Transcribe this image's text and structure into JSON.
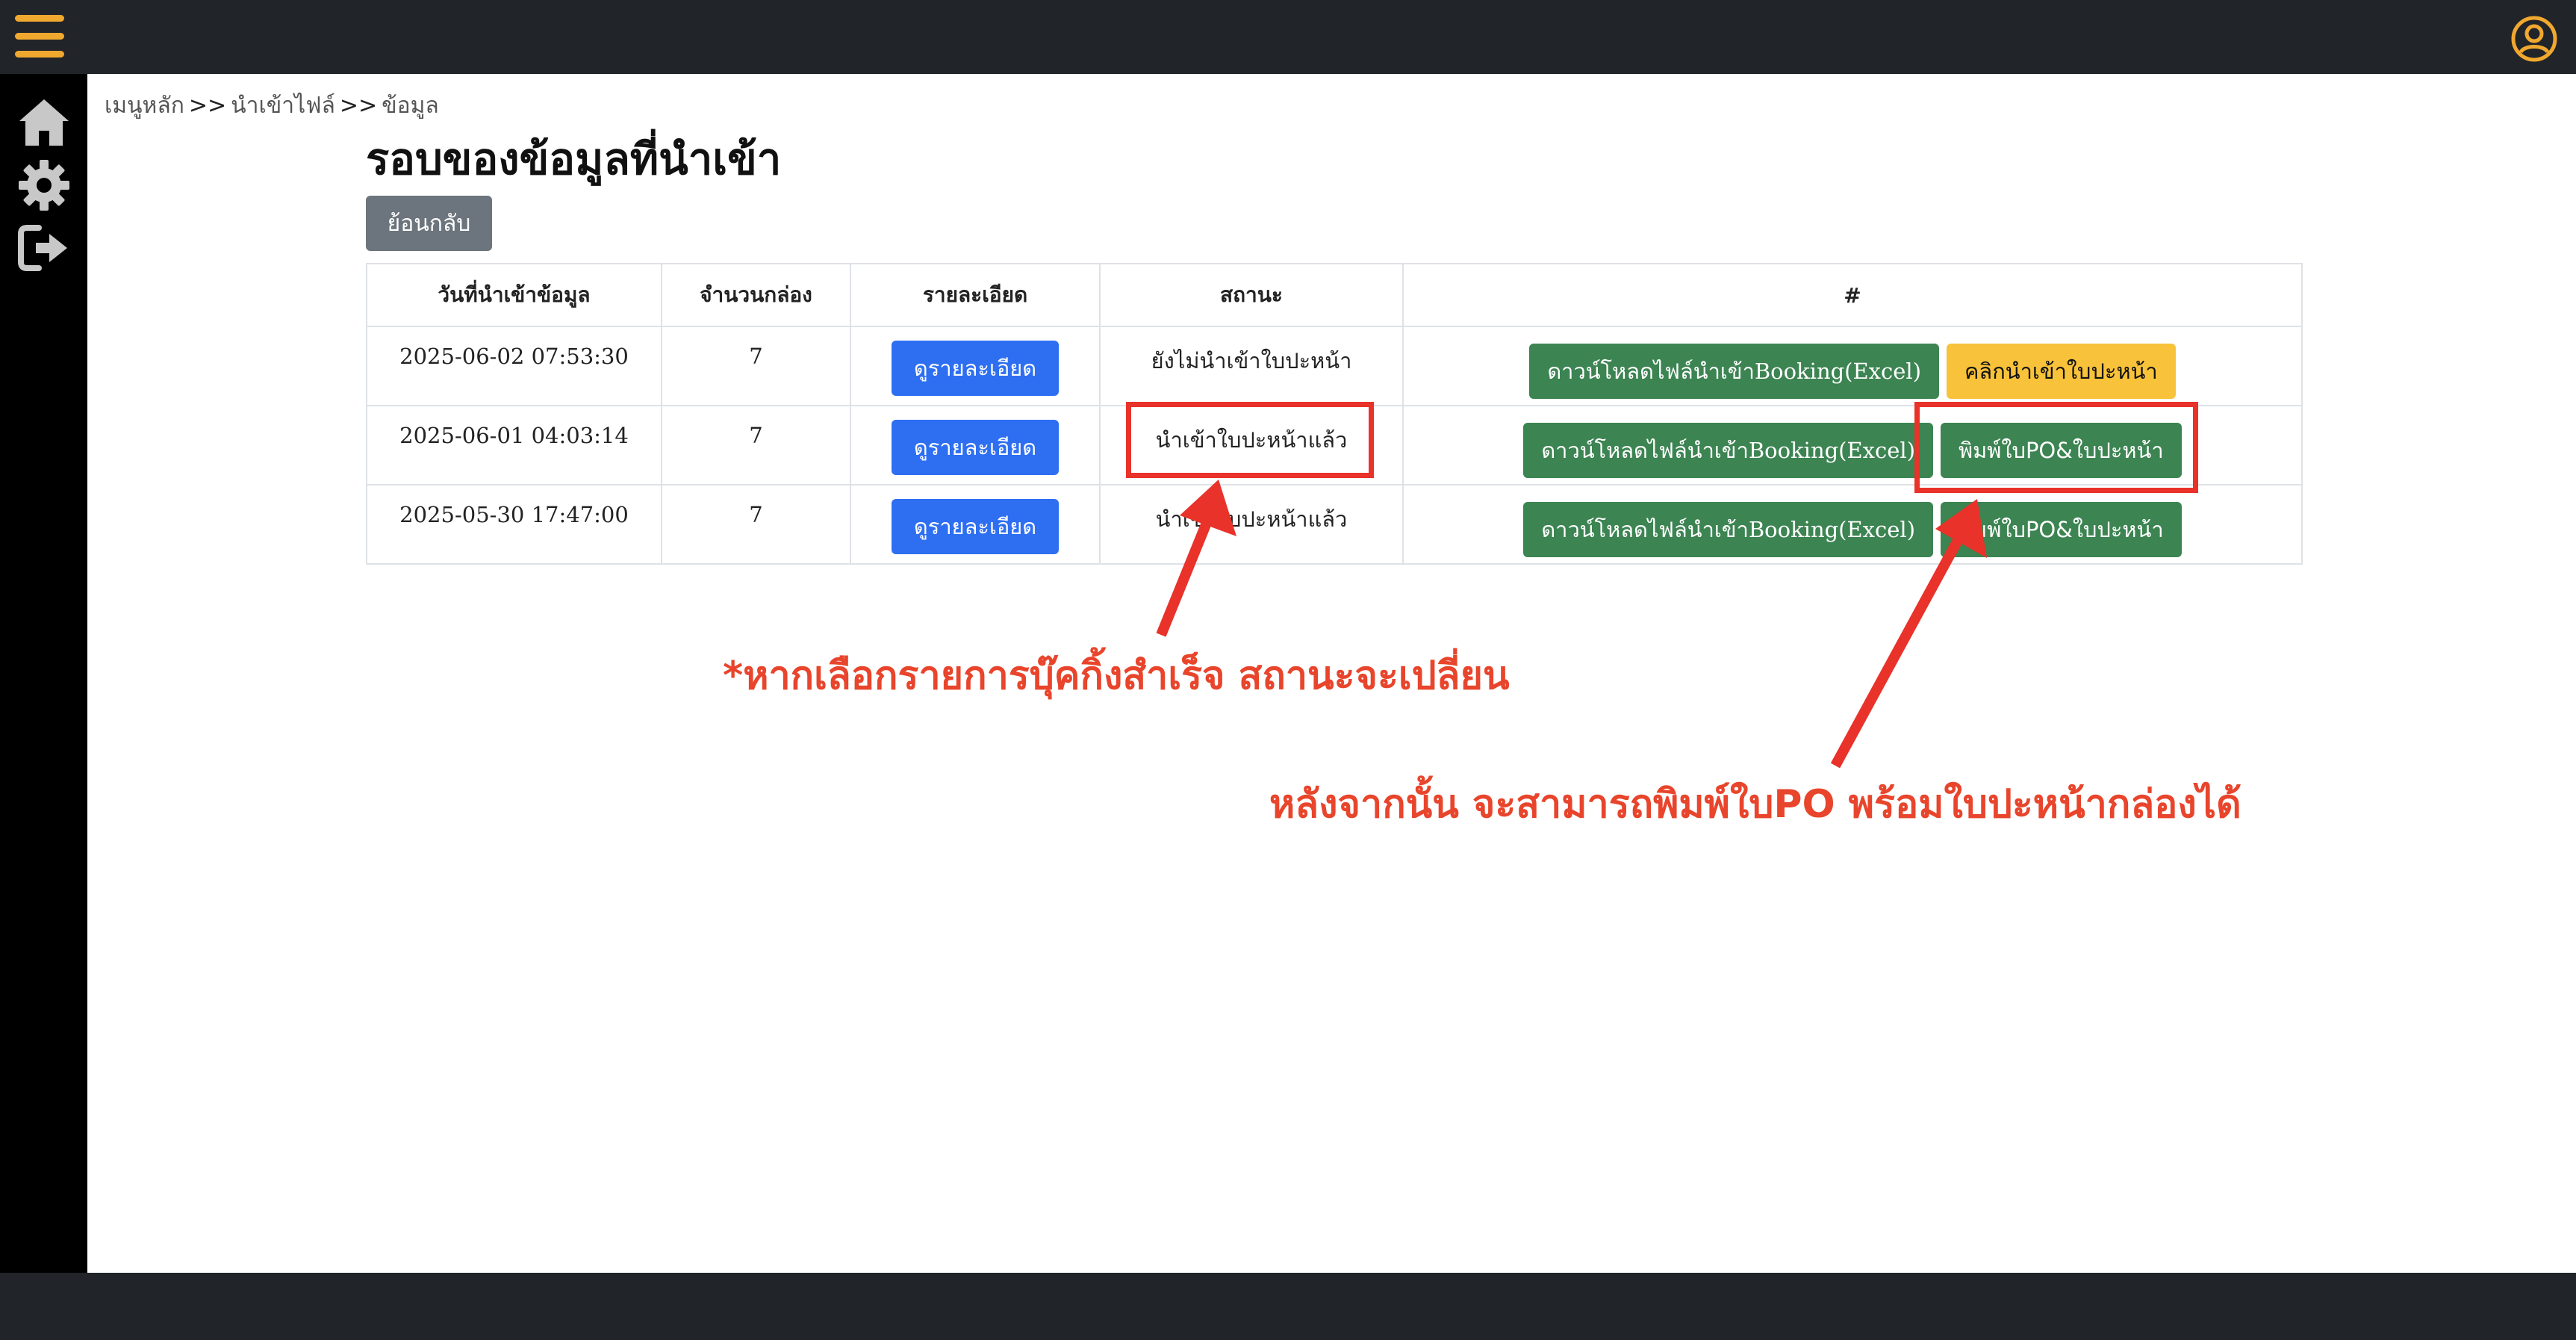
{
  "breadcrumb": {
    "home": "เมนูหลัก",
    "sep": ">>",
    "import_files": "นำเข้าไฟล์",
    "data": "ข้อมูล"
  },
  "page_title": "รอบของข้อมูลที่นำเข้า",
  "back_label": "ย้อนกลับ",
  "table": {
    "headers": [
      "วันที่นำเข้าข้อมูล",
      "จำนวนกล่อง",
      "รายละเอียด",
      "สถานะ",
      "#"
    ],
    "rows": [
      {
        "date": "2025-06-02 07:53:30",
        "boxes": "7",
        "detail": "ดูรายละเอียด",
        "status": "ยังไม่นำเข้าใบปะหน้า",
        "excel": "ดาวน์โหลดไฟล์นำเข้าBooking(Excel)",
        "action": "คลิกนำเข้าใบปะหน้า"
      },
      {
        "date": "2025-06-01 04:03:14",
        "boxes": "7",
        "detail": "ดูรายละเอียด",
        "status": "นำเข้าใบปะหน้าแล้ว",
        "excel": "ดาวน์โหลดไฟล์นำเข้าBooking(Excel)",
        "action": "พิมพ์ใบPO&ใบปะหน้า"
      },
      {
        "date": "2025-05-30 17:47:00",
        "boxes": "7",
        "detail": "ดูรายละเอียด",
        "status": "นำเข้าใบปะหน้าแล้ว",
        "excel": "ดาวน์โหลดไฟล์นำเข้าBooking(Excel)",
        "action": "พิมพ์ใบPO&ใบปะหน้า"
      }
    ]
  },
  "annotations": {
    "note_status": "*หากเลือกรายการบุ๊คกิ้งสำเร็จ สถานะจะเปลี่ยน",
    "note_print": "หลังจากนั้น จะสามารถพิมพ์ใบPO พร้อมใบปะหน้ากล่องได้"
  },
  "icons": {
    "menu": "hamburger-icon",
    "user": "user-circle-icon",
    "home": "home-icon",
    "settings": "gear-icon",
    "logout": "logout-icon"
  },
  "colors": {
    "topbar": "#212429",
    "sidebar": "#000000",
    "accent": "#f0a82e",
    "primary": "#2e6ff2",
    "success": "#3c8452",
    "warning": "#f8c23a",
    "annotation": "#e8322a"
  }
}
